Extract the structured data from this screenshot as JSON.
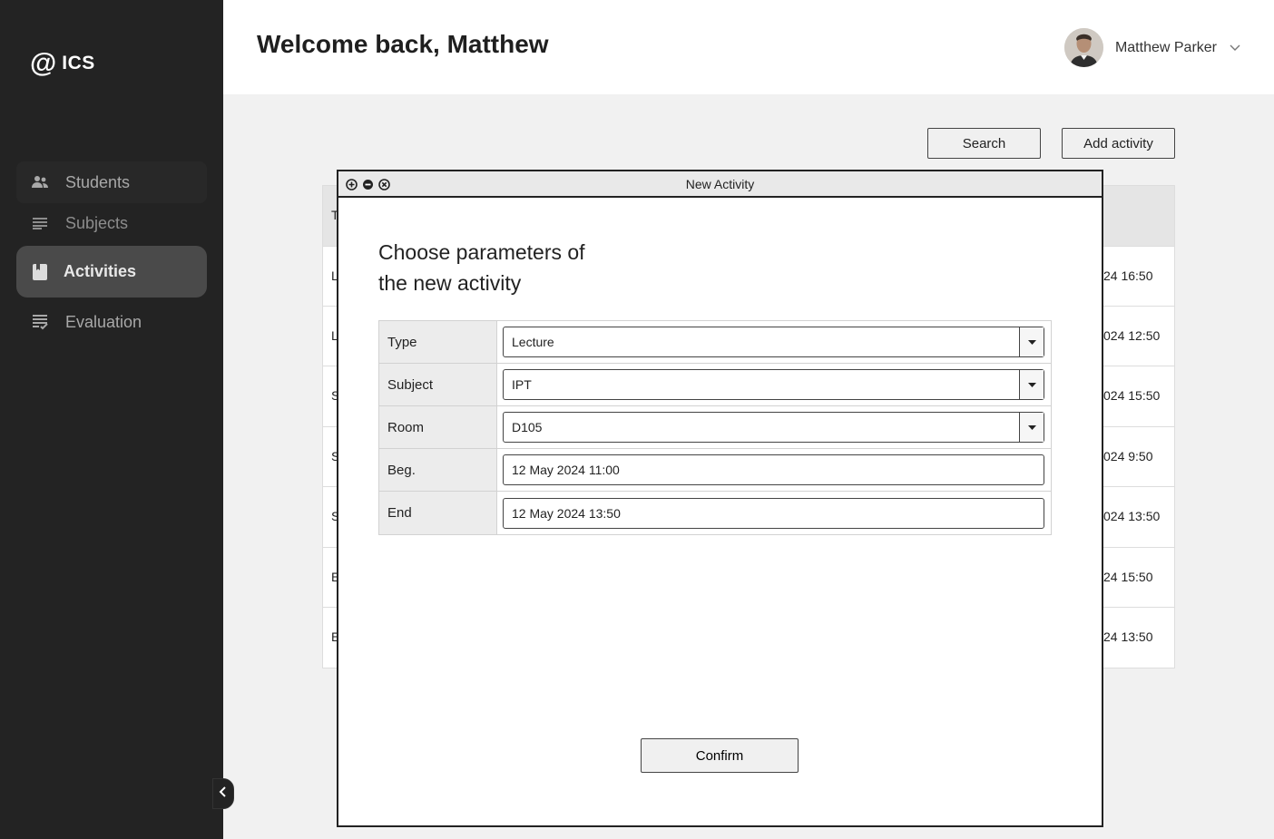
{
  "app": {
    "logo_symbol": "@",
    "logo_text": "ICS"
  },
  "sidebar": {
    "items": [
      {
        "label": "Students",
        "icon": "people-icon"
      },
      {
        "label": "Subjects",
        "icon": "lines-icon"
      },
      {
        "label": "Activities",
        "icon": "bookmark-icon",
        "active": true
      },
      {
        "label": "Evaluation",
        "icon": "checklist-icon"
      }
    ]
  },
  "header": {
    "welcome": "Welcome back, Matthew",
    "user_name": "Matthew Parker"
  },
  "toolbar": {
    "search_label": "Search",
    "add_label": "Add activity"
  },
  "table": {
    "header_first": "T",
    "rows": [
      {
        "c1": "L",
        "c2": "24 16:50"
      },
      {
        "c1": "L",
        "c2": "024 12:50"
      },
      {
        "c1": "S",
        "c2": "024 15:50"
      },
      {
        "c1": "S",
        "c2": "024 9:50"
      },
      {
        "c1": "S",
        "c2": "024 13:50"
      },
      {
        "c1": "E",
        "c2": "24 15:50"
      },
      {
        "c1": "E",
        "c2": "24 13:50"
      }
    ]
  },
  "modal": {
    "title": "New Activity",
    "heading_line1": "Choose parameters of",
    "heading_line2": "the new activity",
    "fields": [
      {
        "label": "Type",
        "value": "Lecture",
        "dropdown": true
      },
      {
        "label": "Subject",
        "value": "IPT",
        "dropdown": true
      },
      {
        "label": "Room",
        "value": "D105",
        "dropdown": true
      },
      {
        "label": "Beg.",
        "value": "12 May 2024 11:00",
        "dropdown": false
      },
      {
        "label": "End",
        "value": "12 May 2024 13:50",
        "dropdown": false
      }
    ],
    "confirm_label": "Confirm"
  },
  "colors": {
    "sidebar_bg": "#232323",
    "active_item_bg": "#4a4a4a",
    "content_bg": "#f1f1f1"
  }
}
